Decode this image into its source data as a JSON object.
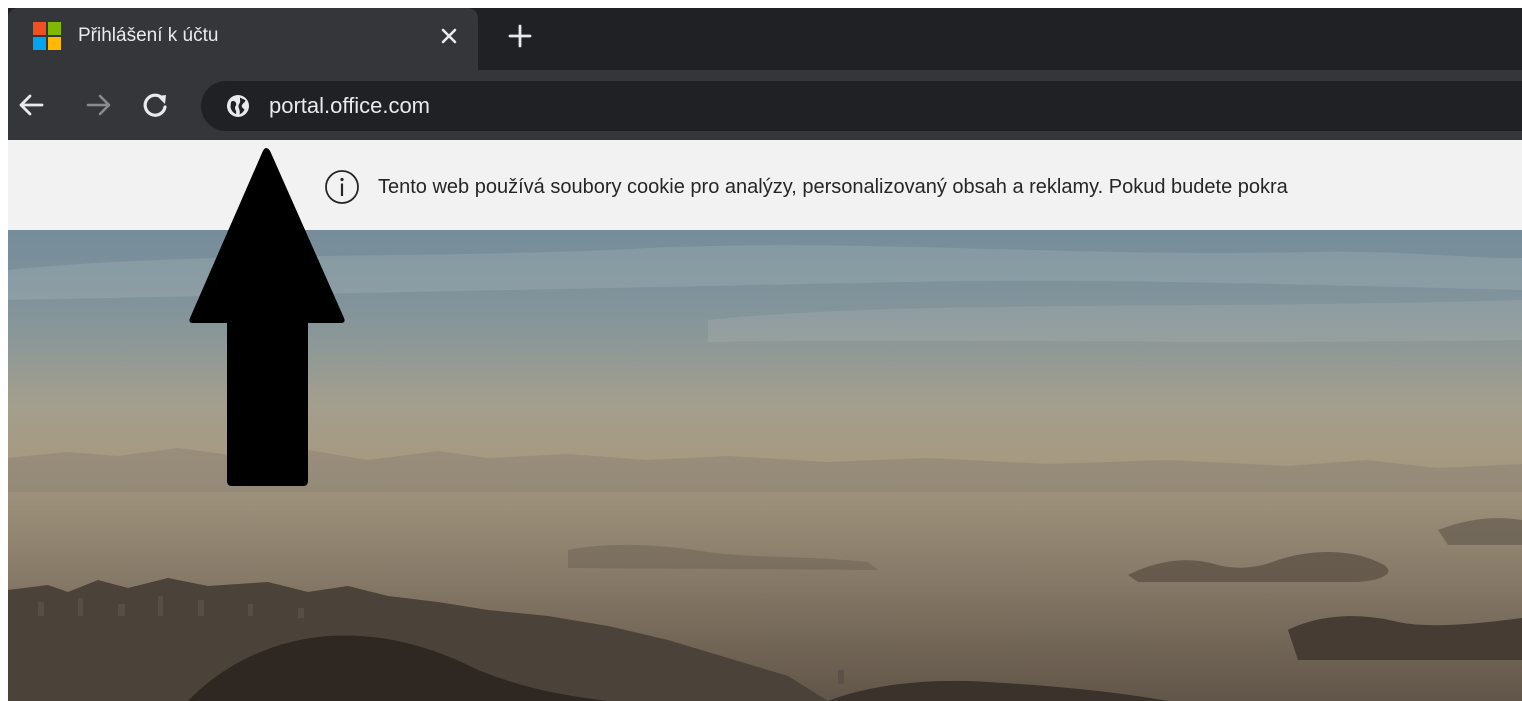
{
  "browser": {
    "tab": {
      "title": "Přihlášení k účtu",
      "favicon": "microsoft-logo-icon",
      "close_icon": "close-icon"
    },
    "new_tab_icon": "plus-icon",
    "toolbar": {
      "back_icon": "arrow-left-icon",
      "forward_icon": "arrow-right-icon",
      "reload_icon": "reload-icon",
      "site_info_icon": "globe-icon",
      "url": "portal.office.com"
    },
    "colors": {
      "tabstrip": "#202124",
      "active_tab": "#35363a",
      "omnibox": "#202124",
      "text": "#e8eaed"
    }
  },
  "cookie_banner": {
    "icon": "info-icon",
    "text": "Tento web používá soubory cookie pro analýzy, personalizovaný obsah a reklamy. Pokud budete pokra"
  },
  "annotation": {
    "icon": "arrow-up-icon",
    "color": "#000000"
  },
  "microsoft_logo_colors": [
    "#f25022",
    "#7fba00",
    "#00a4ef",
    "#ffb900"
  ]
}
